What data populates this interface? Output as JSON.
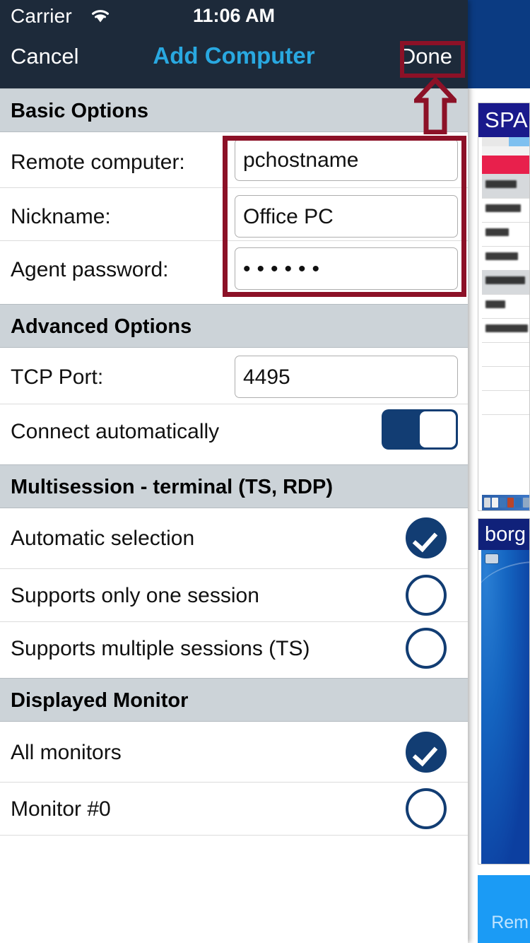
{
  "background_app": {
    "battery_icon": "battery-icon",
    "menu_icon": "list-menu-icon",
    "cards": [
      {
        "title": "SPAR"
      },
      {
        "title": "borg"
      }
    ],
    "bottom_bar_label": "Rem"
  },
  "status_bar": {
    "carrier": "Carrier",
    "wifi_icon": "wifi-icon",
    "time": "11:06 AM"
  },
  "nav_bar": {
    "cancel_label": "Cancel",
    "title": "Add Computer",
    "done_label": "Done",
    "title_color": "#29a8e0",
    "background": "#1d2a3a"
  },
  "sections": [
    {
      "header": "Basic Options",
      "rows": [
        {
          "label": "Remote computer:",
          "value": "pchostname",
          "type": "text"
        },
        {
          "label": "Nickname:",
          "value": "Office PC",
          "type": "text"
        },
        {
          "label": "Agent password:",
          "value": "••••••",
          "type": "password"
        }
      ]
    },
    {
      "header": "Advanced Options",
      "rows": [
        {
          "label": "TCP Port:",
          "value": "4495",
          "type": "text"
        },
        {
          "label": "Connect automatically",
          "value": "on",
          "type": "switch"
        }
      ]
    },
    {
      "header": "Multisession - terminal (TS, RDP)",
      "rows": [
        {
          "label": "Automatic selection",
          "value": "selected",
          "type": "radio"
        },
        {
          "label": "Supports only one session",
          "value": "unselected",
          "type": "radio"
        },
        {
          "label": "Supports multiple sessions (TS)",
          "value": "unselected",
          "type": "radio"
        }
      ]
    },
    {
      "header": "Displayed Monitor",
      "rows": [
        {
          "label": "All monitors",
          "value": "selected",
          "type": "radio"
        },
        {
          "label": "Monitor #0",
          "value": "unselected",
          "type": "radio"
        }
      ]
    }
  ],
  "annotations": {
    "color": "#8c1127",
    "highlight_done_button": "Done",
    "highlight_basic_fields": "Basic Options input fields",
    "arrow_icon": "up-arrow-annotation-icon"
  },
  "theme": {
    "accent_blue": "#123d73",
    "section_header_bg": "#ccd3d8",
    "nav_blue_text": "#29a8e0"
  }
}
